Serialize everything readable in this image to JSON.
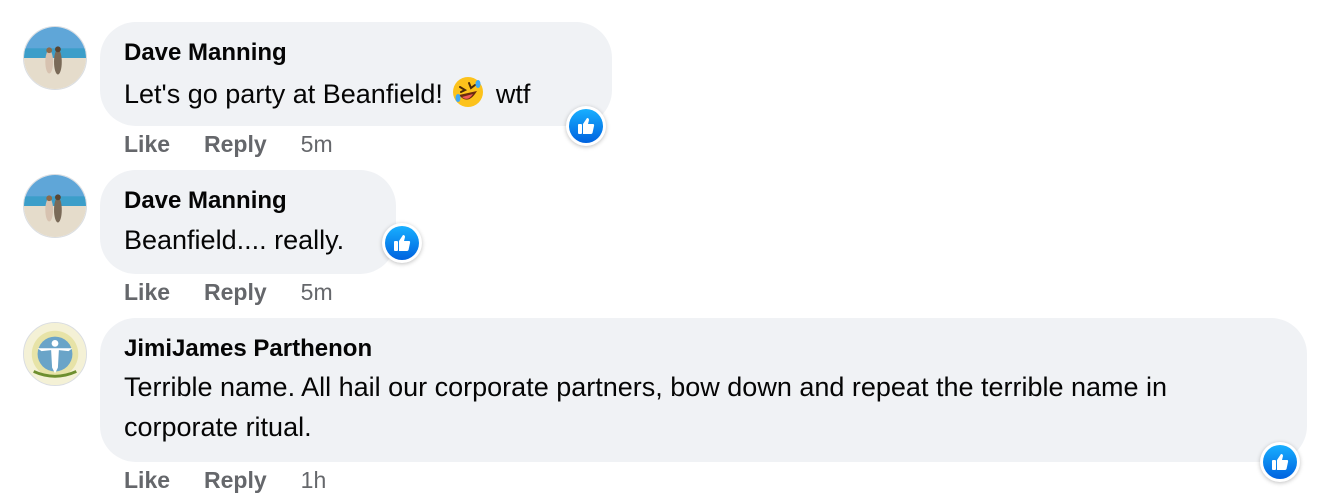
{
  "comments": [
    {
      "author": "Dave Manning",
      "text_before_emoji": "Let's go party at Beanfield!",
      "emoji": "rolling-on-floor-laughing-emoji",
      "text_after_emoji": "wtf",
      "reaction": "like",
      "actions": {
        "like": "Like",
        "reply": "Reply",
        "time": "5m"
      }
    },
    {
      "author": "Dave Manning",
      "text": "Beanfield.... really.",
      "reaction": "like",
      "actions": {
        "like": "Like",
        "reply": "Reply",
        "time": "5m"
      }
    },
    {
      "author": "JimiJames Parthenon",
      "text": "Terrible name. All hail our corporate partners, bow down and repeat the terrible name in corporate ritual.",
      "reaction": "like",
      "actions": {
        "like": "Like",
        "reply": "Reply",
        "time": "1h"
      }
    }
  ],
  "colors": {
    "bubble": "#f0f2f5",
    "meta_text": "#65676b",
    "like_blue": "#0866ff"
  }
}
